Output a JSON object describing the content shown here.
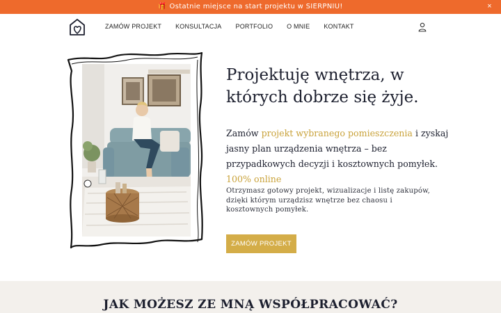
{
  "announcement": {
    "text": "🎁 Ostatnie miejsce na start projektu w SIERPNIU!",
    "close_label": "×"
  },
  "header": {
    "logo_icon": "house-heart-icon",
    "nav": [
      {
        "label": "ZAMÓW PROJEKT"
      },
      {
        "label": "KONSULTACJA"
      },
      {
        "label": "PORTFOLIO"
      },
      {
        "label": "O MNIE"
      },
      {
        "label": "KONTAKT"
      }
    ],
    "account_icon": "user-icon"
  },
  "hero": {
    "title": "Projektuję wnętrza, w których dobrze się żyje.",
    "lead_prefix": "Zamów ",
    "lead_accent": "projekt wybranego pomieszczenia",
    "lead_suffix": " i zyskaj jasny plan urządzenia wnętrza – bez przypadkowych decyzji i kosztownych pomyłek.",
    "lead_online": "100% online",
    "description": "Otrzymasz gotowy projekt,  wizualizacje i listę zakupów, dzięki którym urządzisz wnętrze bez chaosu i kosztownych pomyłek.",
    "cta_label": "ZAMÓW PROJEKT"
  },
  "section2": {
    "title": "JAK MOŻESZ ZE MNĄ WSPÓŁPRACOWAĆ?"
  },
  "colors": {
    "topbar": "#ee6a2c",
    "accent": "#c9a23a",
    "cta": "#d4ad48",
    "lower_bg": "#f3f0ec",
    "text": "#1c1f2e"
  }
}
